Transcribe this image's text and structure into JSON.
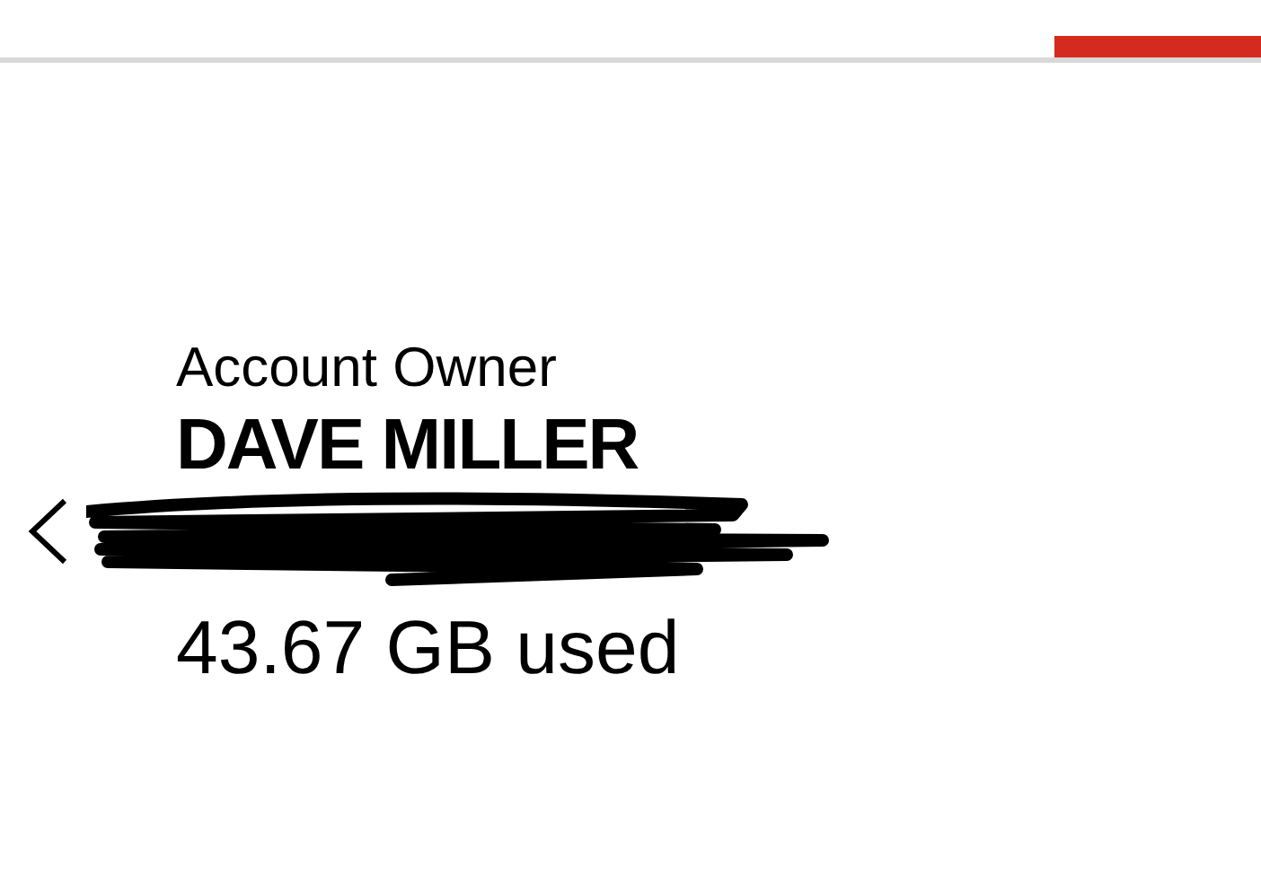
{
  "account": {
    "role": "Account Owner",
    "name": "DAVE MILLER",
    "usage": "43.67 GB used"
  }
}
